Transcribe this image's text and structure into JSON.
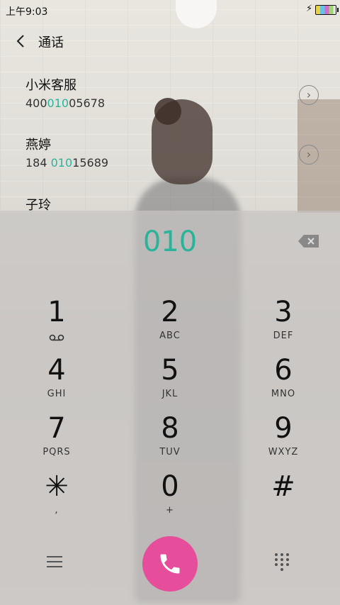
{
  "status_bar": {
    "time": "上午9:03",
    "charging": "⚡"
  },
  "header": {
    "title": "通话"
  },
  "contacts": [
    {
      "name": "小米客服",
      "number_pre": "400",
      "number_match": "010",
      "number_post": "05678"
    },
    {
      "name": "燕婷",
      "number_pre": "184 ",
      "number_match": "010",
      "number_post": "15689"
    },
    {
      "name": "子玲"
    }
  ],
  "dial_input": "010",
  "keys": [
    {
      "digit": "1",
      "letters": ""
    },
    {
      "digit": "2",
      "letters": "ABC"
    },
    {
      "digit": "3",
      "letters": "DEF"
    },
    {
      "digit": "4",
      "letters": "GHI"
    },
    {
      "digit": "5",
      "letters": "JKL"
    },
    {
      "digit": "6",
      "letters": "MNO"
    },
    {
      "digit": "7",
      "letters": "PQRS"
    },
    {
      "digit": "8",
      "letters": "TUV"
    },
    {
      "digit": "9",
      "letters": "WXYZ"
    },
    {
      "digit": "✳",
      "letters": ","
    },
    {
      "digit": "0",
      "letters": "+"
    },
    {
      "digit": "#",
      "letters": ""
    }
  ],
  "icons": [
    "back-arrow-icon",
    "more-info-icon",
    "backspace-icon",
    "voicemail-icon",
    "menu-icon",
    "phone-icon",
    "dialpad-icon"
  ],
  "colors": {
    "accent_green": "#2bb39a",
    "call_button": "#e64d9a"
  }
}
